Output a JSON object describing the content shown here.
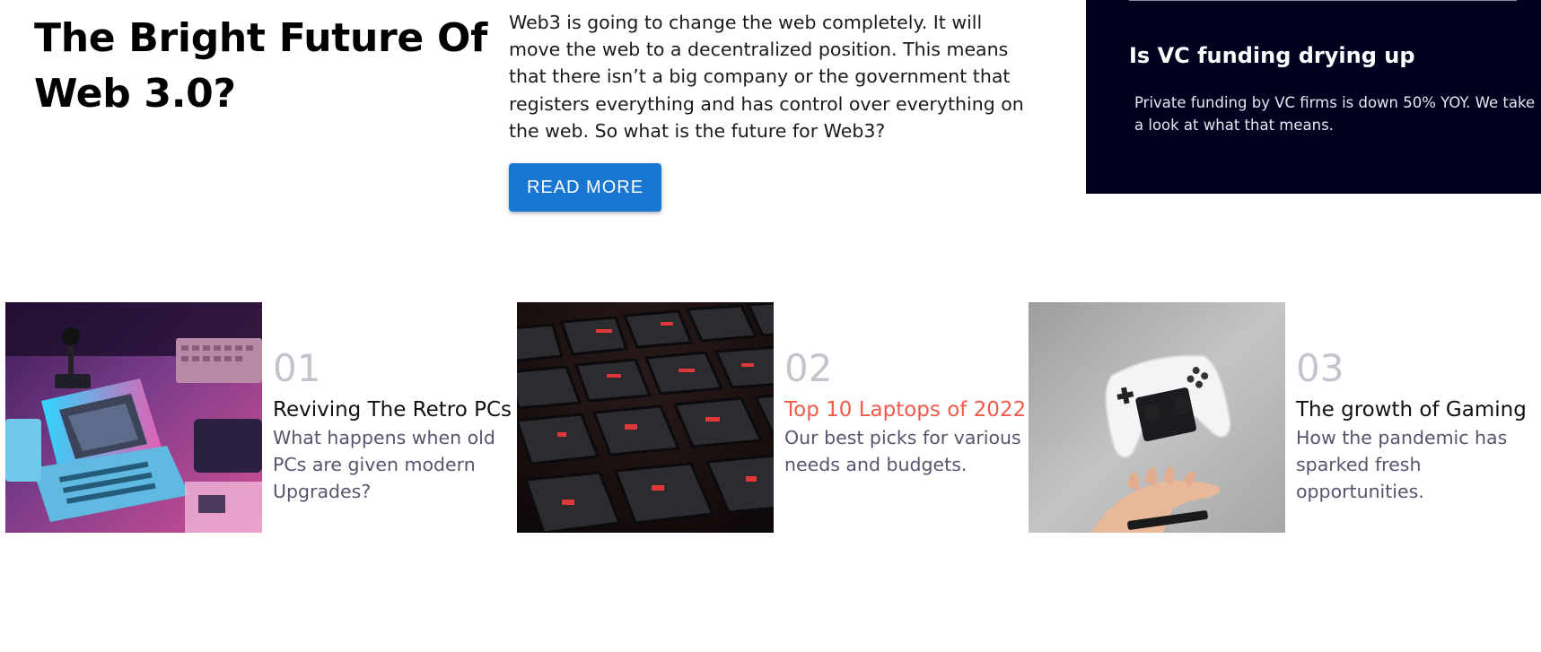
{
  "hero": {
    "title": "The Bright Future Of Web 3.0?",
    "description": "Web3 is going to change the web completely. It will move the web to a decentralized position. This means that there isn’t a big company or the government that registers everything and has control over everything on the web. So what is the future for Web3?",
    "button_label": "READ MORE"
  },
  "promo": {
    "title": "Is VC funding drying up",
    "description": "Private funding by VC firms is down 50% YOY. We take a look at what that means."
  },
  "articles": [
    {
      "number": "01",
      "title": "Reviving The Retro PCs",
      "description": "What happens when old PCs are given modern Upgrades?",
      "image": "retro-pc-image"
    },
    {
      "number": "02",
      "title": "Top 10 Laptops of 2022",
      "description": "Our best picks for various needs and budgets.",
      "image": "laptop-keyboard-image"
    },
    {
      "number": "03",
      "title": "The growth of Gaming",
      "description": "How the pandemic has sparked fresh opportunities.",
      "image": "game-controller-image"
    }
  ],
  "colors": {
    "button": "#1976d2",
    "promo_background": "#00011f",
    "active_title": "#f05a4a",
    "number": "#c4c4cf",
    "description": "#55566e"
  }
}
